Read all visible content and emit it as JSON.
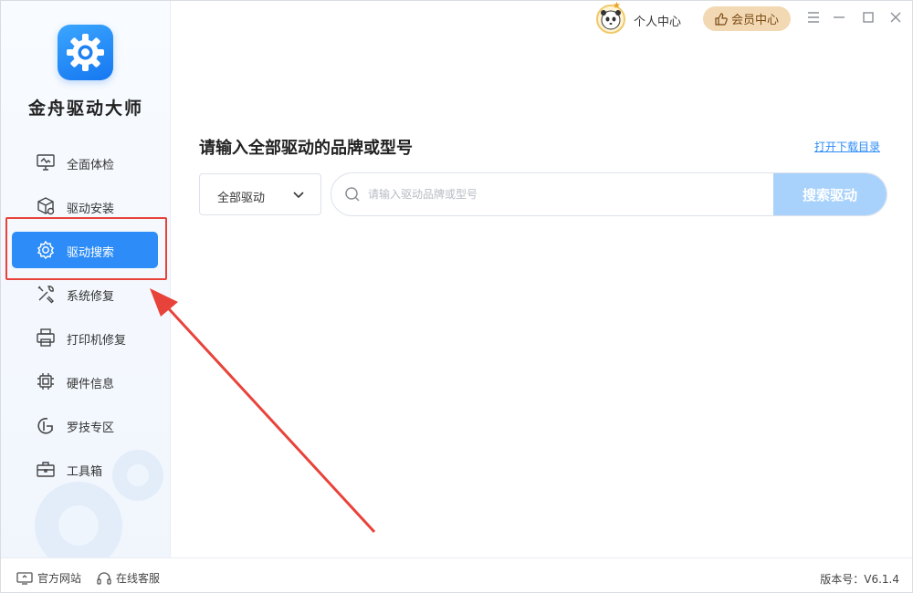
{
  "app": {
    "title": "金舟驱动大师"
  },
  "sidebar": {
    "items": [
      {
        "label": "全面体检",
        "icon": "monitor-check-icon"
      },
      {
        "label": "驱动安装",
        "icon": "box-install-icon"
      },
      {
        "label": "驱动搜索",
        "icon": "gear-search-icon",
        "active": true
      },
      {
        "label": "系统修复",
        "icon": "tools-icon"
      },
      {
        "label": "打印机修复",
        "icon": "printer-icon"
      },
      {
        "label": "硬件信息",
        "icon": "chip-icon"
      },
      {
        "label": "罗技专区",
        "icon": "logitech-icon"
      },
      {
        "label": "工具箱",
        "icon": "toolbox-icon"
      }
    ]
  },
  "topbar": {
    "profile_label": "个人中心",
    "vip_label": "会员中心"
  },
  "main": {
    "heading": "请输入全部驱动的品牌或型号",
    "catalog_link": "打开下载目录",
    "category_select": {
      "value": "全部驱动"
    },
    "search": {
      "placeholder": "请输入驱动品牌或型号",
      "value": "",
      "button_label": "搜索驱动"
    }
  },
  "footer": {
    "official_site": "官方网站",
    "online_service": "在线客服",
    "version": "版本号：V6.1.4"
  },
  "colors": {
    "accent": "#2d8cf7",
    "search_button": "#a8d2fb",
    "highlight": "#e8433b",
    "vip_bg": "#f2d9b3"
  }
}
